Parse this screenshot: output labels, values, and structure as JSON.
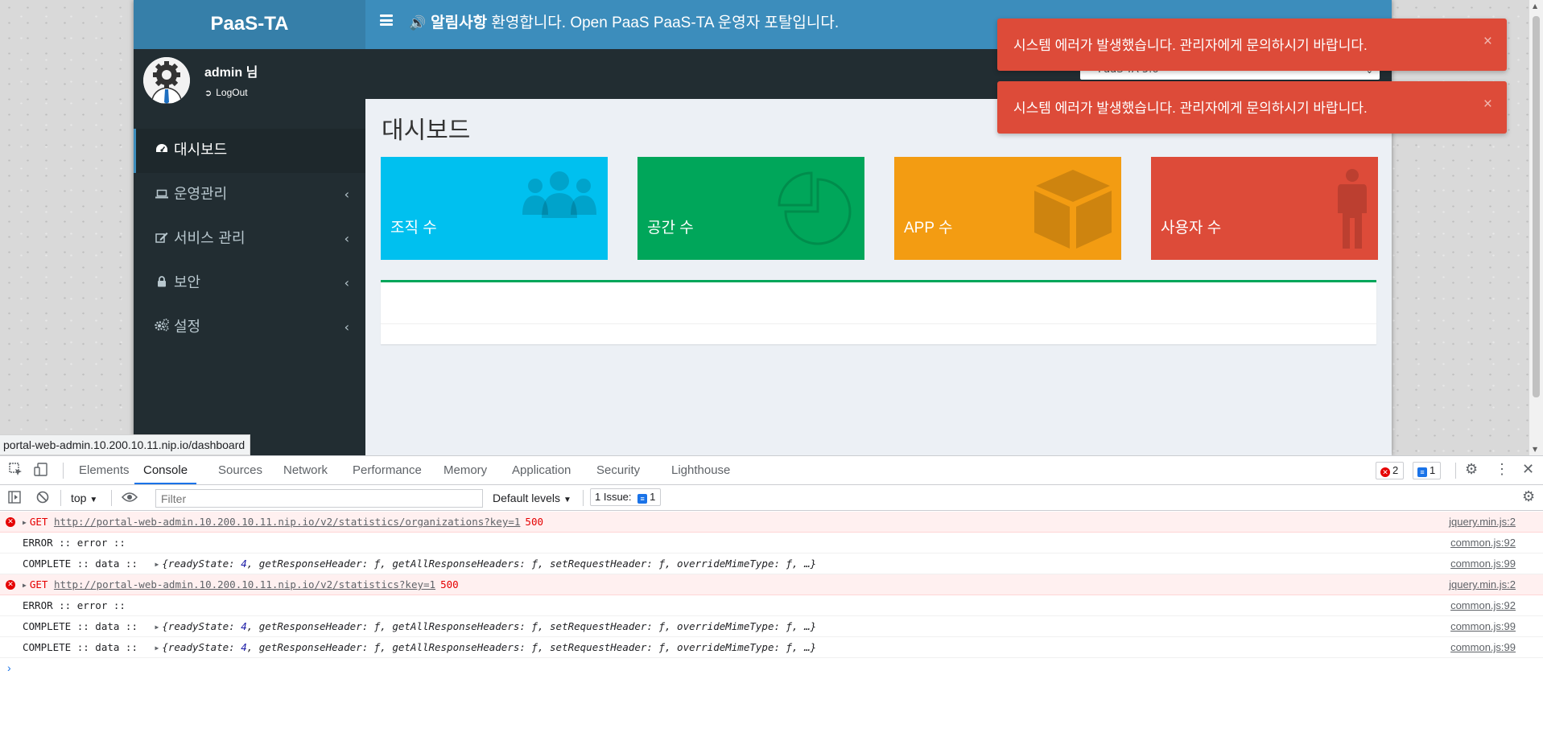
{
  "app": {
    "logo": "PaaS-TA",
    "notice_label": "알림사항",
    "notice_text": "환영합니다. Open PaaS PaaS-TA 운영자 포탈입니다.",
    "version_selected": "PaaS-TA 5.6"
  },
  "user": {
    "name": "admin 님",
    "logout": "LogOut"
  },
  "sidebar": {
    "items": [
      {
        "label": "대시보드",
        "icon": "dashboard-icon"
      },
      {
        "label": "운영관리",
        "icon": "laptop-icon"
      },
      {
        "label": "서비스 관리",
        "icon": "edit-icon"
      },
      {
        "label": "보안",
        "icon": "lock-icon"
      },
      {
        "label": "설정",
        "icon": "gears-icon"
      }
    ]
  },
  "main": {
    "title": "대시보드",
    "boxes": [
      {
        "label": "조직 수",
        "color": "#00c0ef",
        "icon": "users-icon"
      },
      {
        "label": "공간 수",
        "color": "#00a65a",
        "icon": "pie-chart-icon"
      },
      {
        "label": "APP 수",
        "color": "#f39c12",
        "icon": "cube-icon"
      },
      {
        "label": "사용자 수",
        "color": "#dd4b39",
        "icon": "male-icon"
      }
    ]
  },
  "toasts": [
    {
      "message": "시스템 에러가 발생했습니다. 관리자에게 문의하시기 바랍니다."
    },
    {
      "message": "시스템 에러가 발생했습니다. 관리자에게 문의하시기 바랍니다."
    }
  ],
  "status_url": "portal-web-admin.10.200.10.11.nip.io/dashboard",
  "devtools": {
    "tabs": [
      "Elements",
      "Console",
      "Sources",
      "Network",
      "Performance",
      "Memory",
      "Application",
      "Security",
      "Lighthouse"
    ],
    "active_tab": "Console",
    "error_count": "2",
    "issue_count": "1",
    "context": "top",
    "filter_placeholder": "Filter",
    "levels": "Default levels",
    "issues_label": "1 Issue:",
    "issues_count": "1",
    "console_rows": [
      {
        "type": "error",
        "method": "GET",
        "url": "http://portal-web-admin.10.200.10.11.nip.io/v2/statistics/organizations?key=1",
        "status": "500",
        "source": "jquery.min.js:2"
      },
      {
        "type": "log",
        "text": "ERROR :: error ::",
        "source": "common.js:92"
      },
      {
        "type": "obj",
        "text": "COMPLETE :: data ::",
        "obj_pre": "{readyState: ",
        "obj_num": "4",
        "obj_post": ", getResponseHeader: ƒ, getAllResponseHeaders: ƒ, setRequestHeader: ƒ, overrideMimeType: ƒ, …}",
        "source": "common.js:99"
      },
      {
        "type": "error",
        "method": "GET",
        "url": "http://portal-web-admin.10.200.10.11.nip.io/v2/statistics?key=1",
        "status": "500",
        "source": "jquery.min.js:2"
      },
      {
        "type": "log",
        "text": "ERROR :: error ::",
        "source": "common.js:92"
      },
      {
        "type": "obj",
        "text": "COMPLETE :: data ::",
        "obj_pre": "{readyState: ",
        "obj_num": "4",
        "obj_post": ", getResponseHeader: ƒ, getAllResponseHeaders: ƒ, setRequestHeader: ƒ, overrideMimeType: ƒ, …}",
        "source": "common.js:99"
      },
      {
        "type": "obj",
        "text": "COMPLETE :: data ::",
        "obj_pre": "{readyState: ",
        "obj_num": "4",
        "obj_post": ", getResponseHeader: ƒ, getAllResponseHeaders: ƒ, setRequestHeader: ƒ, overrideMimeType: ƒ, …}",
        "source": "common.js:99"
      }
    ]
  }
}
